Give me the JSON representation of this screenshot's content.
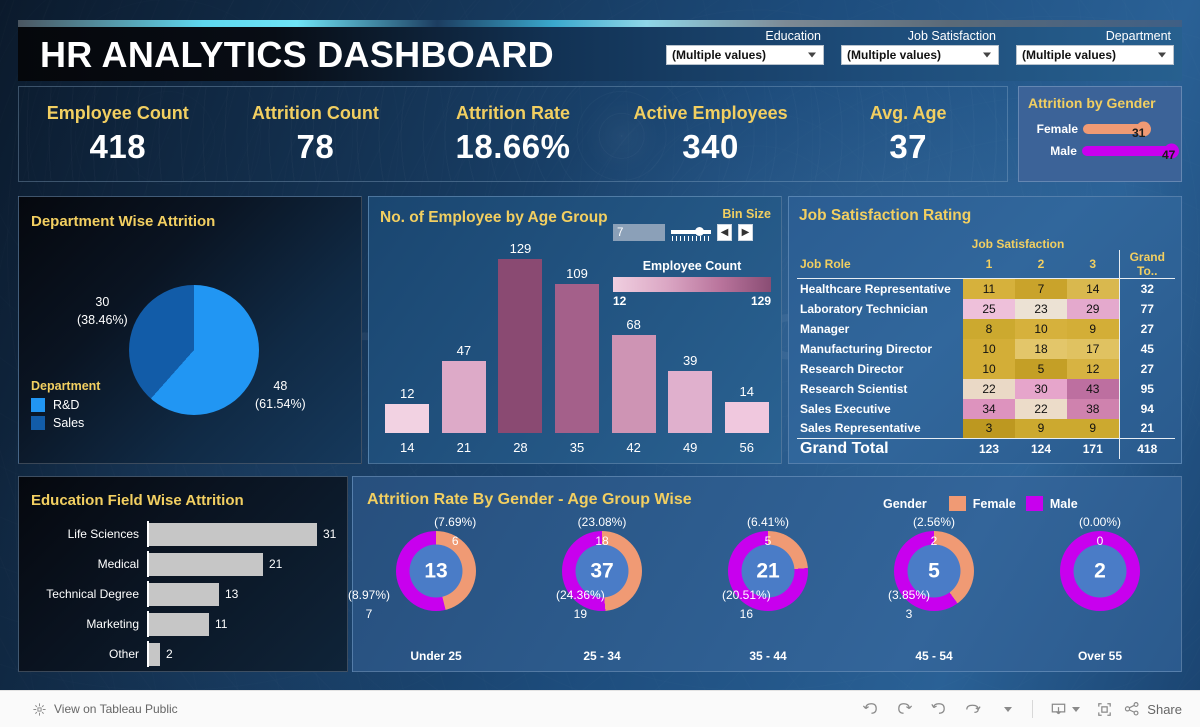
{
  "header": {
    "title": "HR ANALYTICS DASHBOARD",
    "filters": [
      {
        "label": "Education",
        "value": "(Multiple values)",
        "icon": "chevron-down-icon"
      },
      {
        "label": "Job Satisfaction",
        "value": "(Multiple values)",
        "icon": "chevron-down-icon"
      },
      {
        "label": "Department",
        "value": "(Multiple values)",
        "icon": "chevron-down-icon"
      }
    ]
  },
  "kpis": [
    {
      "label": "Employee Count",
      "value": "418"
    },
    {
      "label": "Attrition Count",
      "value": "78"
    },
    {
      "label": "Attrition Rate",
      "value": "18.66%"
    },
    {
      "label": "Active Employees",
      "value": "340"
    },
    {
      "label": "Avg. Age",
      "value": "37"
    }
  ],
  "attrition_by_gender": {
    "title": "Attrition by Gender",
    "rows": [
      {
        "label": "Female",
        "value": "31",
        "num": 31,
        "color": "#f09a74"
      },
      {
        "label": "Male",
        "value": "47",
        "num": 47,
        "color": "#c800ee"
      }
    ],
    "max": 47
  },
  "department_attrition": {
    "title": "Department Wise Attrition",
    "legend_title": "Department",
    "chart_data": {
      "type": "pie",
      "title": "Department Wise Attrition",
      "categories": [
        "R&D",
        "Sales"
      ],
      "values": [
        48,
        30
      ],
      "percent_labels": [
        "(61.54%)",
        "(38.46%)"
      ],
      "value_labels": [
        "48",
        "30"
      ],
      "colors": [
        "#2196f3",
        "#125ca8"
      ],
      "legend_position": "bottom-left"
    }
  },
  "age_group": {
    "title": "No. of Employee by Age Group",
    "bin_title": "Bin Size",
    "bin_value": "7",
    "prev_icon": "chevron-left-icon",
    "next_icon": "chevron-right-icon",
    "legend_title": "Employee Count",
    "legend_min": "12",
    "legend_max": "129",
    "chart_data": {
      "type": "bar",
      "title": "No. of Employee by Age Group",
      "xlabel": "",
      "ylabel": "Employee Count",
      "categories": [
        "14",
        "21",
        "28",
        "35",
        "42",
        "49",
        "56"
      ],
      "values": [
        12,
        47,
        129,
        109,
        68,
        39,
        14
      ],
      "ylim": [
        0,
        129
      ],
      "grid": false,
      "colors": [
        "#f2d2e2",
        "#ddaac8",
        "#8a4a72",
        "#a4608a",
        "#ce94b4",
        "#e0b0cd",
        "#f0c8de"
      ]
    }
  },
  "job_satisfaction": {
    "title": "Job Satisfaction Rating",
    "column_group": "Job Satisfaction",
    "chart_data": {
      "type": "table",
      "title": "Job Satisfaction Rating",
      "columns": [
        "Job Role",
        "1",
        "2",
        "3",
        "Grand To.."
      ],
      "rows": [
        {
          "role": "Healthcare Representative",
          "values": [
            11,
            7,
            14
          ],
          "total": 32,
          "colors": [
            "#d6b13c",
            "#c9a32b",
            "#d9b84e"
          ]
        },
        {
          "role": "Laboratory Technician",
          "values": [
            25,
            23,
            29
          ],
          "total": 77,
          "colors": [
            "#eec0da",
            "#ece2d4",
            "#e4a9cd"
          ]
        },
        {
          "role": "Manager",
          "values": [
            8,
            10,
            9
          ],
          "total": 27,
          "colors": [
            "#cca92f",
            "#d6b13c",
            "#d3ae37"
          ]
        },
        {
          "role": "Manufacturing Director",
          "values": [
            10,
            18,
            17
          ],
          "total": 45,
          "colors": [
            "#d3ae37",
            "#e3c66a",
            "#e0c261"
          ]
        },
        {
          "role": "Research Director",
          "values": [
            10,
            5,
            12
          ],
          "total": 27,
          "colors": [
            "#d3ae37",
            "#c49f26",
            "#d7b342"
          ]
        },
        {
          "role": "Research Scientist",
          "values": [
            22,
            30,
            43
          ],
          "total": 95,
          "colors": [
            "#ead9c6",
            "#e6a5cb",
            "#bd6fa0"
          ]
        },
        {
          "role": "Sales Executive",
          "values": [
            34,
            22,
            38
          ],
          "total": 94,
          "colors": [
            "#dd93be",
            "#ecdcc9",
            "#cf82ae"
          ]
        },
        {
          "role": "Sales Representative",
          "values": [
            3,
            9,
            9
          ],
          "total": 21,
          "colors": [
            "#bd9820",
            "#cca92f",
            "#cca92f"
          ]
        }
      ],
      "grand_total_label": "Grand Total",
      "grand_totals": [
        123,
        124,
        171
      ],
      "grand_total": 418
    }
  },
  "education_attrition": {
    "title": "Education Field Wise  Attrition",
    "chart_data": {
      "type": "bar",
      "orientation": "horizontal",
      "title": "Education Field Wise Attrition",
      "categories": [
        "Life Sciences",
        "Medical",
        "Technical Degree",
        "Marketing",
        "Other"
      ],
      "values": [
        31,
        21,
        13,
        11,
        2
      ],
      "ylim": [
        0,
        31
      ],
      "grid": false,
      "color": "#c6c6c6"
    }
  },
  "gender_age_attrition": {
    "title": "Attrition Rate By Gender - Age Group Wise",
    "legend_title": "Gender",
    "legend": [
      {
        "label": "Female",
        "color": "#f09a74"
      },
      {
        "label": "Male",
        "color": "#c800ee"
      }
    ],
    "chart_data": {
      "type": "pie",
      "subtype": "donut",
      "title": "Attrition Rate By Gender - Age Group Wise",
      "categories": [
        "Under 25",
        "25 - 34",
        "35 - 44",
        "45 - 54",
        "Over 55"
      ],
      "totals": [
        13,
        37,
        21,
        5,
        2
      ],
      "series": [
        {
          "name": "Female",
          "values": [
            6,
            18,
            5,
            2,
            0
          ],
          "percents": [
            "(7.69%)",
            "(23.08%)",
            "(6.41%)",
            "(2.56%)",
            "(0.00%)"
          ],
          "color": "#f09a74"
        },
        {
          "name": "Male",
          "values": [
            7,
            19,
            16,
            3,
            2
          ],
          "percents": [
            "(8.97%)",
            "(24.36%)",
            "(20.51%)",
            "(3.85%)",
            "(0.00%)"
          ],
          "color": "#c800ee"
        }
      ],
      "legend_position": "top-right"
    }
  },
  "toolbar": {
    "view_link": "View on Tableau Public",
    "tableau_icon": "tableau-logo-icon",
    "share_label": "Share",
    "buttons": [
      {
        "name": "undo-button",
        "icon": "undo-icon"
      },
      {
        "name": "redo-button",
        "icon": "redo-icon"
      },
      {
        "name": "revert-button",
        "icon": "revert-icon"
      },
      {
        "name": "refresh-button",
        "icon": "refresh-icon"
      },
      {
        "name": "pause-dropdown-button",
        "icon": "chevron-down-icon"
      },
      {
        "name": "download-button",
        "icon": "download-icon"
      },
      {
        "name": "fullscreen-button",
        "icon": "fullscreen-icon"
      },
      {
        "name": "share-button",
        "icon": "share-icon"
      }
    ]
  },
  "watermark": "HUMAN RESOURCES"
}
